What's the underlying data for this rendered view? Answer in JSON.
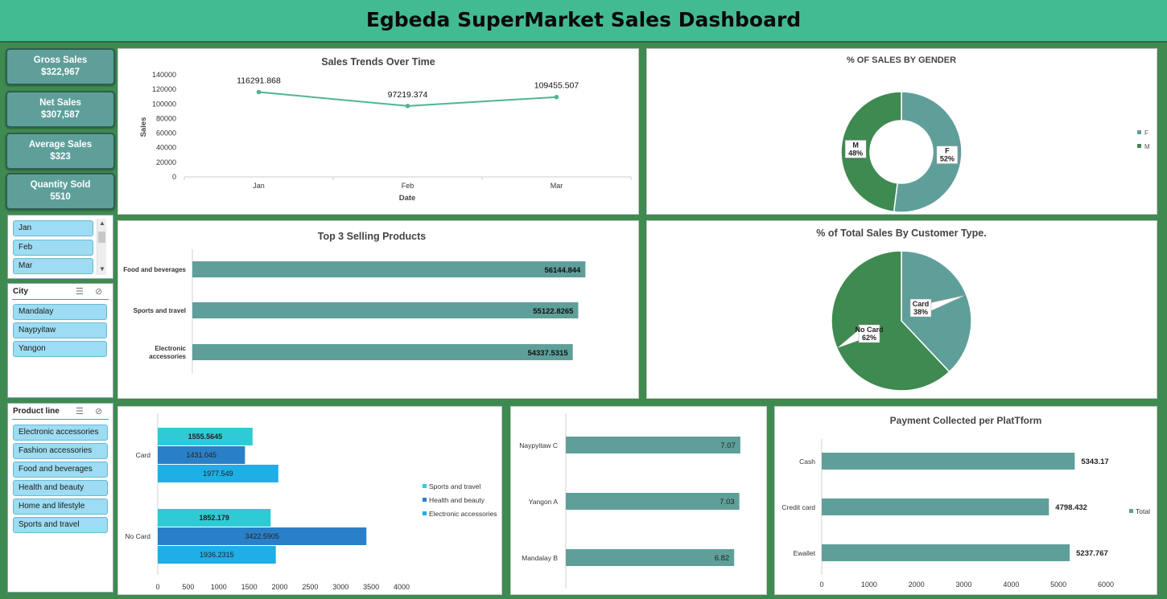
{
  "dashboard_title": "Egbeda SuperMarket Sales Dashboard",
  "kpis": [
    {
      "label": "Gross Sales",
      "value": "$322,967"
    },
    {
      "label": "Net Sales",
      "value": "$307,587"
    },
    {
      "label": "Average Sales",
      "value": "$323"
    },
    {
      "label": "Quantity Sold",
      "value": "5510"
    }
  ],
  "month_slicer": {
    "items": [
      "Jan",
      "Feb",
      "Mar"
    ]
  },
  "city_slicer": {
    "title": "City",
    "items": [
      "Mandalay",
      "Naypyitaw",
      "Yangon"
    ]
  },
  "product_slicer": {
    "title": "Product line",
    "items": [
      "Electronic accessories",
      "Fashion accessories",
      "Food and beverages",
      "Health and beauty",
      "Home and lifestyle",
      "Sports and travel"
    ]
  },
  "colors": {
    "teal": "#5f9f9a",
    "green": "#3e8a50",
    "cyan": "#2ecbd5",
    "blue": "#2a80c8",
    "skyblue": "#1faee6"
  },
  "chart_data": [
    {
      "id": "trend",
      "type": "line",
      "title": "Sales Trends Over Time",
      "xlabel": "Date",
      "ylabel": "Sales",
      "categories": [
        "Jan",
        "Feb",
        "Mar"
      ],
      "values": [
        116291.868,
        97219.374,
        109455.507
      ],
      "data_labels": [
        "116291.868",
        "97219.374",
        "109455.507"
      ],
      "ylim": [
        0,
        140000
      ],
      "yticks": [
        "0",
        "20000",
        "40000",
        "60000",
        "80000",
        "100000",
        "120000",
        "140000"
      ]
    },
    {
      "id": "gender",
      "type": "pie",
      "donut": true,
      "title": "% OF SALES BY GENDER",
      "categories": [
        "F",
        "M"
      ],
      "values": [
        52,
        48
      ],
      "data_labels": [
        [
          "F",
          "52%"
        ],
        [
          "M",
          "48%"
        ]
      ],
      "legend": [
        "F",
        "M"
      ],
      "legend_position": "right"
    },
    {
      "id": "top3",
      "type": "bar",
      "orientation": "horizontal",
      "title": "Top 3 Selling Products",
      "categories": [
        [
          "Food and beverages"
        ],
        [
          "Sports and travel"
        ],
        [
          "Electronic",
          "accessories"
        ]
      ],
      "values": [
        56144.844,
        55122.8265,
        54337.5315
      ],
      "data_labels": [
        "56144.844",
        "55122.8265",
        "54337.5315"
      ],
      "xlim": [
        0,
        63000
      ]
    },
    {
      "id": "customer",
      "type": "pie",
      "title": "% of Total Sales By Customer Type.",
      "categories": [
        "Card",
        "No Card"
      ],
      "values": [
        38,
        62
      ],
      "data_labels": [
        [
          "Card",
          "38%"
        ],
        [
          "No Card",
          "62%"
        ]
      ]
    },
    {
      "id": "payment_product",
      "type": "bar",
      "orientation": "horizontal",
      "title": "",
      "categories": [
        "Card",
        "No Card"
      ],
      "series": [
        {
          "name": "Sports and travel",
          "values": [
            1555.5645,
            1852.179
          ],
          "labels": [
            "1555.5645",
            "1852.179"
          ]
        },
        {
          "name": "Health and beauty",
          "values": [
            1431.045,
            3422.5905
          ],
          "labels": [
            "1431.045",
            "3422.5905"
          ]
        },
        {
          "name": "Electronic accessories",
          "values": [
            1977.549,
            1936.2315
          ],
          "labels": [
            "1977.549",
            "1936.2315"
          ]
        }
      ],
      "xlim": [
        0,
        4000
      ],
      "xticks": [
        "0",
        "500",
        "1000",
        "1500",
        "2000",
        "2500",
        "3000",
        "3500",
        "4000"
      ],
      "legend_position": "right"
    },
    {
      "id": "rating",
      "type": "bar",
      "orientation": "horizontal",
      "title": "",
      "categories": [
        "Naypyitaw C",
        "Yangon A",
        "Mandalay B"
      ],
      "values": [
        7.07,
        7.03,
        6.82
      ],
      "data_labels": [
        "7.07",
        "7.03",
        "6.82"
      ],
      "xlim": [
        0,
        7.4
      ]
    },
    {
      "id": "platform",
      "type": "bar",
      "orientation": "horizontal",
      "title": "Payment Collected per PlatTform",
      "categories": [
        "Cash",
        "Credit card",
        "Ewallet"
      ],
      "values": [
        5343.17,
        4798.432,
        5237.767
      ],
      "data_labels": [
        "5343.17",
        "4798.432",
        "5237.767"
      ],
      "xlim": [
        0,
        6000
      ],
      "xticks": [
        "0",
        "1000",
        "2000",
        "3000",
        "4000",
        "5000",
        "6000"
      ],
      "legend": [
        "Total"
      ],
      "legend_position": "right"
    }
  ]
}
